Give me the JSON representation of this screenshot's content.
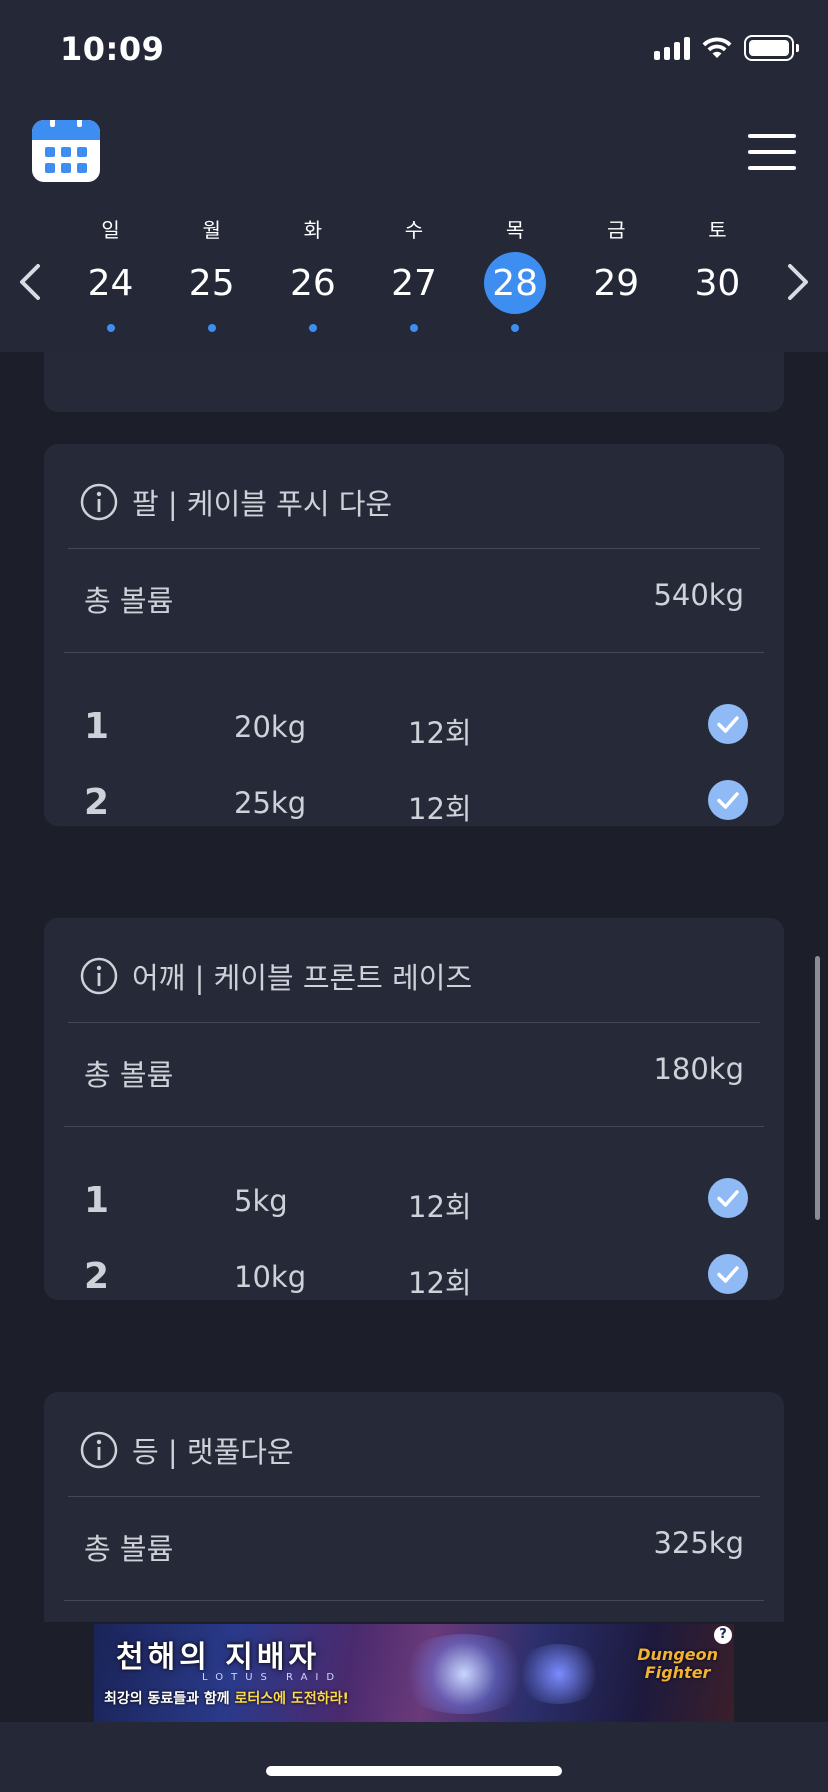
{
  "status_bar": {
    "time": "10:09"
  },
  "calendar": {
    "weekdays": [
      "일",
      "월",
      "화",
      "수",
      "목",
      "금",
      "토"
    ],
    "days": [
      "24",
      "25",
      "26",
      "27",
      "28",
      "29",
      "30"
    ],
    "selected_day": "28"
  },
  "workouts": [
    {
      "title": "팔 | 케이블 푸시 다운",
      "volume_label": "총 볼륨",
      "volume_value": "540kg",
      "sets": [
        {
          "num": "1",
          "weight": "20kg",
          "reps": "12회",
          "done": true
        },
        {
          "num": "2",
          "weight": "25kg",
          "reps": "12회",
          "done": true
        }
      ]
    },
    {
      "title": "어깨 | 케이블 프론트 레이즈",
      "volume_label": "총 볼륨",
      "volume_value": "180kg",
      "sets": [
        {
          "num": "1",
          "weight": "5kg",
          "reps": "12회",
          "done": true
        },
        {
          "num": "2",
          "weight": "10kg",
          "reps": "12회",
          "done": true
        }
      ]
    },
    {
      "title": "등 | 랫풀다운",
      "volume_label": "총 볼륨",
      "volume_value": "325kg",
      "sets": []
    }
  ],
  "ad": {
    "title": "천해의 지배자",
    "subtitle": "LOTUS RAID",
    "tagline_prefix": "최강의 동료들과 함께 ",
    "tagline_highlight": "로터스에 도전하라!",
    "logo_line1": "Dungeon",
    "logo_line2": "Fighter",
    "help": "?"
  },
  "colors": {
    "accent": "#3e8ef2",
    "header_bg": "#242837",
    "page_bg": "#1c1e2a",
    "card_bg": "#262a38",
    "check": "#8fbaf5"
  }
}
